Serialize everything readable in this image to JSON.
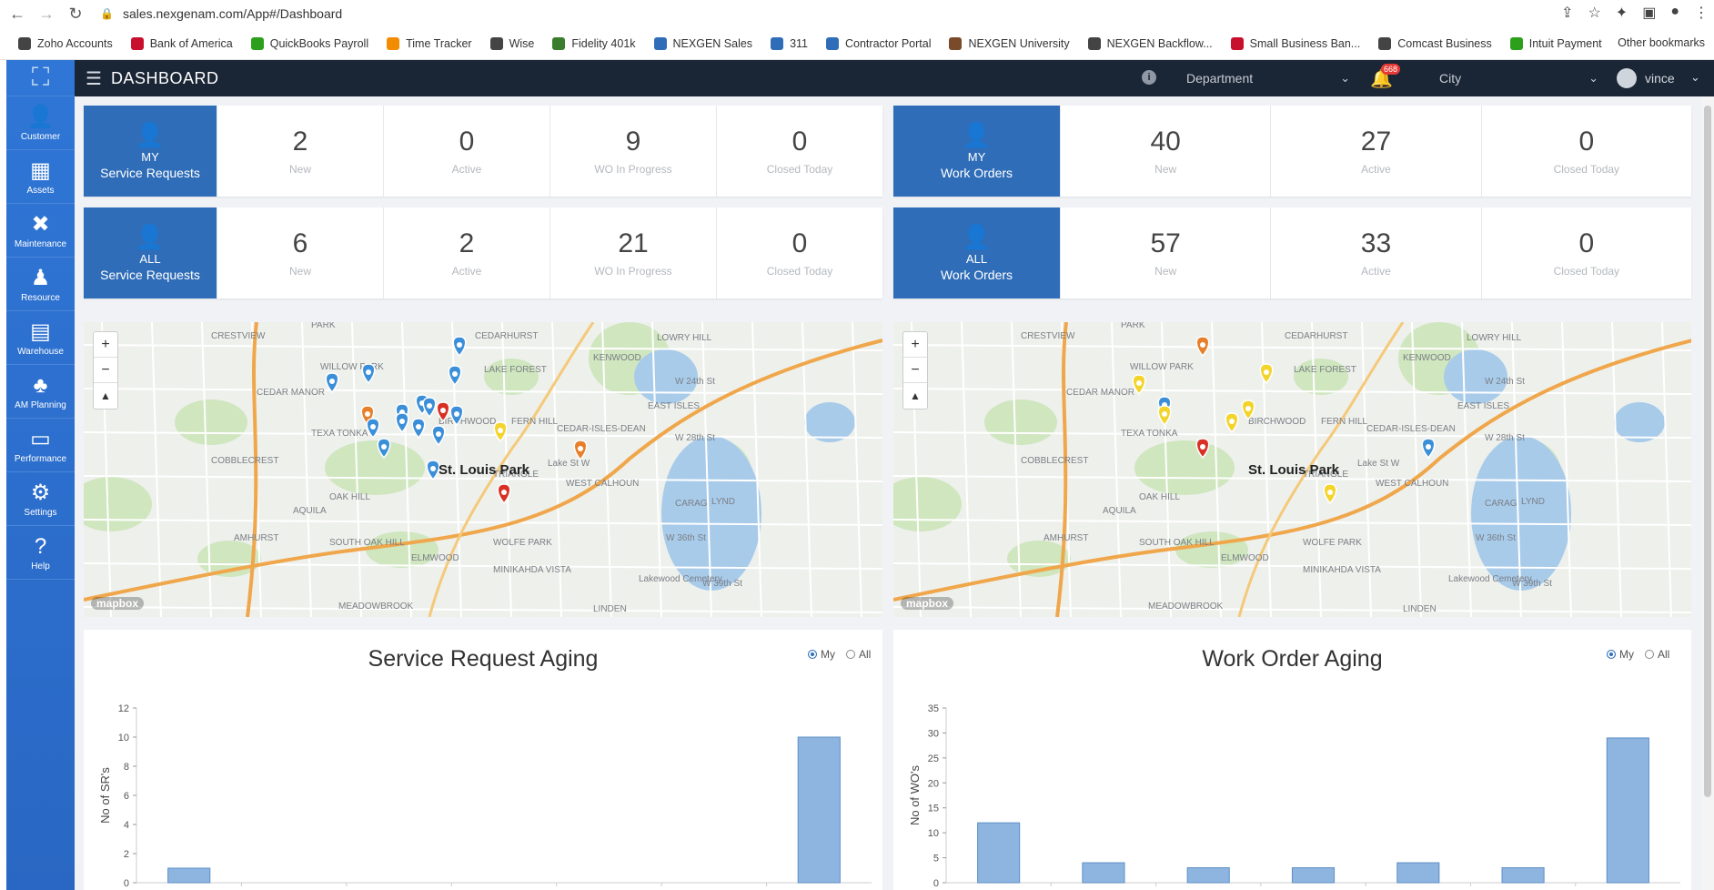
{
  "browser": {
    "url": "sales.nexgenam.com/App#/Dashboard",
    "bookmarks": [
      {
        "label": "Zoho Accounts",
        "color": "#444"
      },
      {
        "label": "Bank of America",
        "color": "#c8102e"
      },
      {
        "label": "QuickBooks Payroll",
        "color": "#2ca01c"
      },
      {
        "label": "Time Tracker",
        "color": "#f28c00"
      },
      {
        "label": "Wise",
        "color": "#444"
      },
      {
        "label": "Fidelity 401k",
        "color": "#3a7d2f"
      },
      {
        "label": "NEXGEN Sales",
        "color": "#2f6db8"
      },
      {
        "label": "311",
        "color": "#2f6db8"
      },
      {
        "label": "Contractor Portal",
        "color": "#2f6db8"
      },
      {
        "label": "NEXGEN University",
        "color": "#7a4b2a"
      },
      {
        "label": "NEXGEN Backflow...",
        "color": "#444"
      },
      {
        "label": "Small Business Ban...",
        "color": "#c8102e"
      },
      {
        "label": "Comcast Business",
        "color": "#444"
      },
      {
        "label": "Intuit Payment",
        "color": "#2ca01c"
      }
    ],
    "other_bookmarks": "Other bookmarks"
  },
  "sidebar": {
    "items": [
      {
        "label": "Customer",
        "icon": "customer-icon",
        "glyph": "👤"
      },
      {
        "label": "Assets",
        "icon": "assets-icon",
        "glyph": "▦"
      },
      {
        "label": "Maintenance",
        "icon": "maintenance-icon",
        "glyph": "✖"
      },
      {
        "label": "Resource",
        "icon": "resource-icon",
        "glyph": "♟"
      },
      {
        "label": "Warehouse",
        "icon": "warehouse-icon",
        "glyph": "▤"
      },
      {
        "label": "AM Planning",
        "icon": "planning-icon",
        "glyph": "♣"
      },
      {
        "label": "Performance",
        "icon": "performance-icon",
        "glyph": "▭"
      },
      {
        "label": "Settings",
        "icon": "settings-icon",
        "glyph": "⚙"
      },
      {
        "label": "Help",
        "icon": "help-icon",
        "glyph": "?"
      }
    ]
  },
  "header": {
    "title": "DASHBOARD",
    "department_placeholder": "Department",
    "city_placeholder": "City",
    "notification_count": "668",
    "user": "vince"
  },
  "stats": {
    "my_sr": {
      "line1": "MY",
      "line2": "Service Requests",
      "items": [
        {
          "value": "2",
          "label": "New"
        },
        {
          "value": "0",
          "label": "Active"
        },
        {
          "value": "9",
          "label": "WO In Progress"
        },
        {
          "value": "0",
          "label": "Closed Today"
        }
      ]
    },
    "all_sr": {
      "line1": "ALL",
      "line2": "Service Requests",
      "items": [
        {
          "value": "6",
          "label": "New"
        },
        {
          "value": "2",
          "label": "Active"
        },
        {
          "value": "21",
          "label": "WO In Progress"
        },
        {
          "value": "0",
          "label": "Closed Today"
        }
      ]
    },
    "my_wo": {
      "line1": "MY",
      "line2": "Work Orders",
      "items": [
        {
          "value": "40",
          "label": "New"
        },
        {
          "value": "27",
          "label": "Active"
        },
        {
          "value": "0",
          "label": "Closed Today"
        }
      ]
    },
    "all_wo": {
      "line1": "ALL",
      "line2": "Work Orders",
      "items": [
        {
          "value": "57",
          "label": "New"
        },
        {
          "value": "33",
          "label": "Active"
        },
        {
          "value": "0",
          "label": "Closed Today"
        }
      ]
    }
  },
  "maps": {
    "city_label": "St. Louis Park",
    "attribution": "mapbox",
    "labels": [
      "CRESTVIEW",
      "PARK",
      "CEDARHURST",
      "LOWRY HILL",
      "KENWOOD",
      "WILLOW PARK",
      "LAKE FOREST",
      "CEDAR MANOR",
      "EAST ISLES",
      "BIRCHWOOD",
      "FERN HILL",
      "CEDAR-ISLES-DEAN",
      "TEXA TONKA",
      "COBBLECREST",
      "TRIANGLE",
      "WEST CALHOUN",
      "OAK HILL",
      "AQUILA",
      "AMHURST",
      "SOUTH OAK HILL",
      "ELMWOOD",
      "WOLFE PARK",
      "MINIKAHDA VISTA",
      "MEADOWBROOK",
      "LINDEN",
      "Lakewood Cemetery",
      "W 24th St",
      "W 28th St",
      "Lake St W",
      "W 36th St",
      "W 39th St",
      "CARAG",
      "LYND"
    ]
  },
  "marker_colors": {
    "blue": "#3b8fd9",
    "orange": "#e87f2b",
    "red": "#d93025",
    "yellow": "#f2d42a"
  },
  "charts": {
    "radio_my": "My",
    "radio_all": "All"
  },
  "chart_data": [
    {
      "type": "bar",
      "title": "Service Request Aging",
      "ylabel": "No of SR's",
      "xlabel": "",
      "ylim": [
        0,
        12
      ],
      "yticks": [
        0,
        2,
        4,
        6,
        8,
        10,
        12
      ],
      "values": [
        1,
        0,
        0,
        0,
        0,
        0,
        10
      ]
    },
    {
      "type": "bar",
      "title": "Work Order Aging",
      "ylabel": "No of WO's",
      "xlabel": "",
      "ylim": [
        0,
        35
      ],
      "yticks": [
        0,
        5,
        10,
        15,
        20,
        25,
        30,
        35
      ],
      "values": [
        12,
        4,
        3,
        3,
        4,
        3,
        29
      ]
    }
  ]
}
